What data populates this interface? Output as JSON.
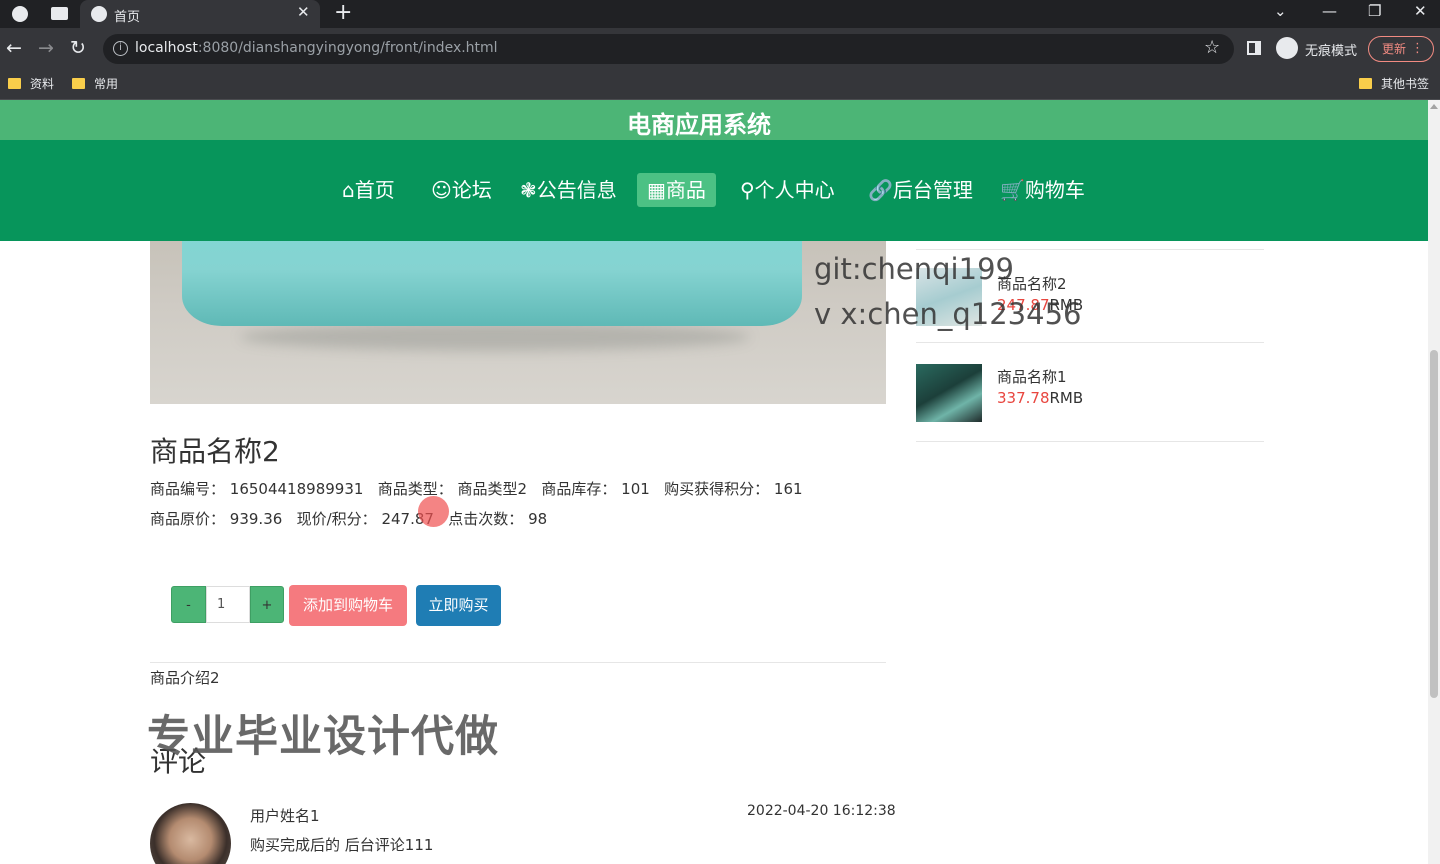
{
  "browser": {
    "tab_title": "首页",
    "url_host": "localhost",
    "url_rest": ":8080/dianshangyingyong/front/index.html",
    "incognito_label": "无痕模式",
    "update_label": "更新",
    "bookmarks": [
      "资料",
      "常用"
    ],
    "other_bookmarks": "其他书签"
  },
  "site": {
    "title": "电商应用系统",
    "nav": [
      {
        "icon": "⌂",
        "label": "首页"
      },
      {
        "icon": "☺",
        "label": "论坛"
      },
      {
        "icon": "❃",
        "label": "公告信息"
      },
      {
        "icon": "▦",
        "label": "商品"
      },
      {
        "icon": "⚲",
        "label": "个人中心"
      },
      {
        "icon": "🔗",
        "label": "后台管理"
      },
      {
        "icon": "🛒",
        "label": "购物车"
      }
    ],
    "active_nav": "商品"
  },
  "watermark": {
    "line1": "git:chenqi199",
    "line2": "v x:chen_q123456",
    "big": "专业毕业设计代做"
  },
  "product": {
    "name": "商品名称2",
    "code_label": "商品编号：",
    "code": "16504418989931",
    "type_label": "商品类型：",
    "type": "商品类型2",
    "stock_label": "商品库存：",
    "stock": "101",
    "points_label": "购买获得积分：",
    "points": "161",
    "orig_price_label": "商品原价：",
    "orig_price": "939.36",
    "cur_price_label": "现价/积分：",
    "cur_price": "247.87",
    "clicks_label": "点击次数：",
    "clicks": "98",
    "qty_minus": "-",
    "qty": "1",
    "qty_plus": "+",
    "add_cart": "添加到购物车",
    "buy_now": "立即购买",
    "intro": "商品介绍2"
  },
  "sidebar": {
    "items": [
      {
        "name": "商品名称2",
        "price": "247.87",
        "unit": "RMB"
      },
      {
        "name": "商品名称1",
        "price": "337.78",
        "unit": "RMB"
      }
    ]
  },
  "comments": {
    "heading": "评论",
    "items": [
      {
        "user": "用户姓名1",
        "time": "2022-04-20 16:12:38",
        "text": "购买完成后的 后台评论111"
      }
    ]
  }
}
